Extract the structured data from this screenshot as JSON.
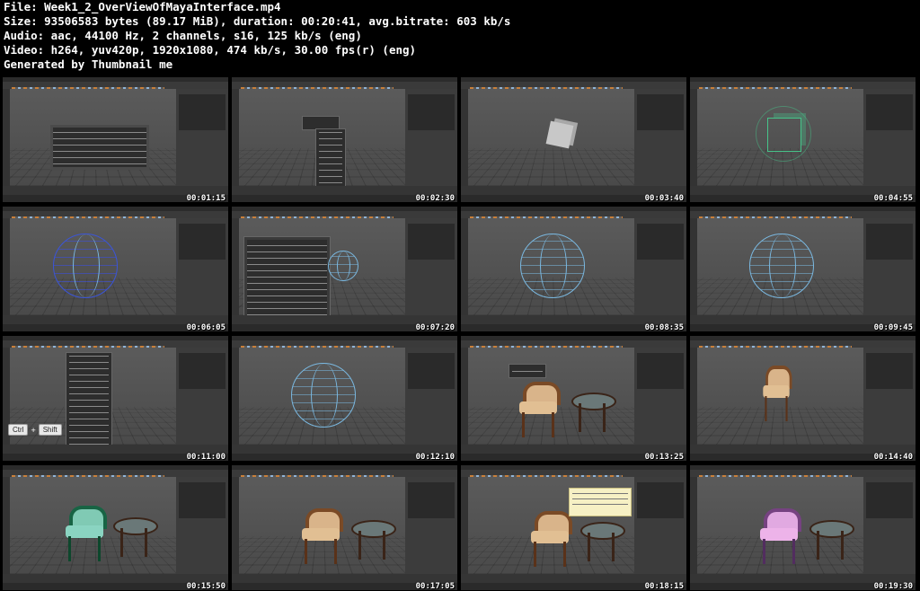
{
  "header": {
    "file": "File: Week1_2_OverViewOfMayaInterface.mp4",
    "size": "Size: 93506583 bytes (89.17 MiB), duration: 00:20:41, avg.bitrate: 603 kb/s",
    "audio": "Audio: aac, 44100 Hz, 2 channels, s16, 125 kb/s (eng)",
    "video": "Video: h264, yuv420p, 1920x1080, 474 kb/s, 30.00 fps(r) (eng)",
    "generator": "Generated by Thumbnail me"
  },
  "thumbnails": [
    {
      "time": "00:01:15",
      "scene": "hotbox-menu"
    },
    {
      "time": "00:02:30",
      "scene": "context-menu"
    },
    {
      "time": "00:03:40",
      "scene": "cube"
    },
    {
      "time": "00:04:55",
      "scene": "wire-cube"
    },
    {
      "time": "00:06:05",
      "scene": "sphere-manipulator"
    },
    {
      "time": "00:07:20",
      "scene": "options-dialog"
    },
    {
      "time": "00:08:35",
      "scene": "sphere"
    },
    {
      "time": "00:09:45",
      "scene": "sphere"
    },
    {
      "time": "00:11:00",
      "scene": "marking-menu-keys"
    },
    {
      "time": "00:12:10",
      "scene": "sphere"
    },
    {
      "time": "00:13:25",
      "scene": "chair-table-menu"
    },
    {
      "time": "00:14:40",
      "scene": "chair-side"
    },
    {
      "time": "00:15:50",
      "scene": "chair-selected"
    },
    {
      "time": "00:17:05",
      "scene": "chair-table"
    },
    {
      "time": "00:18:15",
      "scene": "chair-tooltip"
    },
    {
      "time": "00:19:30",
      "scene": "chair-pink"
    }
  ],
  "keys": {
    "ctrl": "Ctrl",
    "plus": "+",
    "shift": "Shift"
  },
  "colors": {
    "background": "#000000",
    "viewport": "#4f4f4f",
    "wireframe": "#7ab8e0",
    "accent": "#c9803a"
  }
}
